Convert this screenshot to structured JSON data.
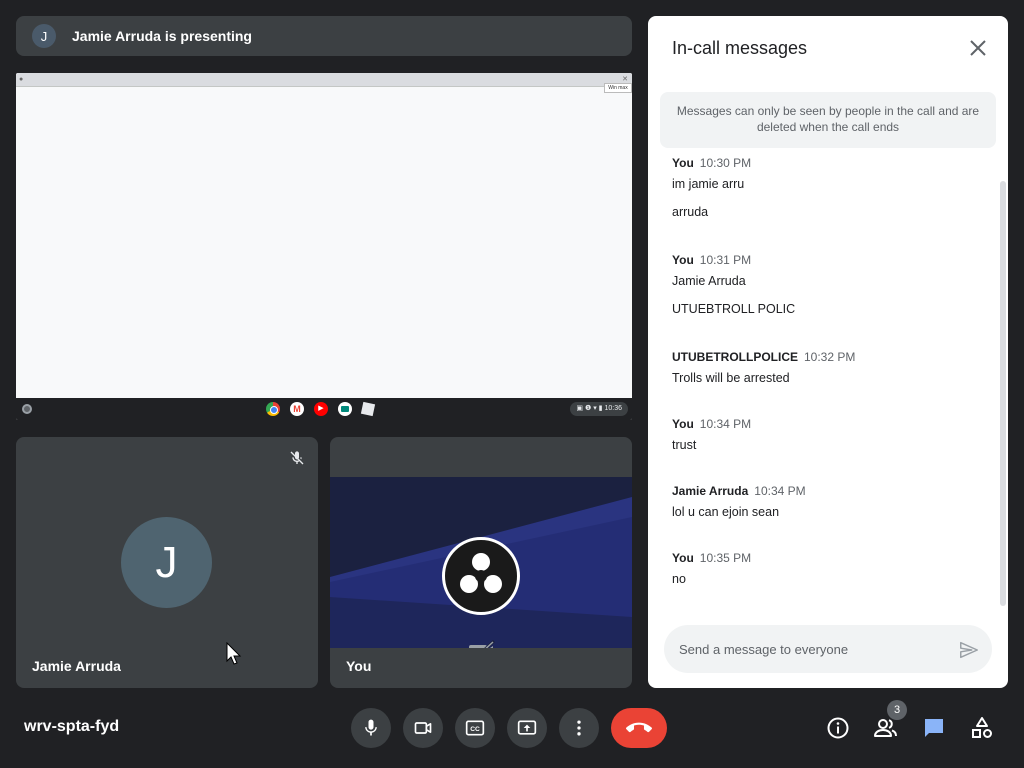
{
  "banner": {
    "avatar_initial": "J",
    "text": "Jamie Arruda is presenting"
  },
  "presentation": {
    "min_button": "Win max",
    "shelf_apps": [
      "chrome-icon",
      "gmail-icon",
      "youtube-icon",
      "meet-icon",
      "roblox-icon"
    ],
    "clock": "10:36"
  },
  "tiles": {
    "jamie": {
      "name": "Jamie Arruda",
      "initial": "J",
      "muted": true
    },
    "you": {
      "name": "You",
      "camera_off": true
    }
  },
  "chat": {
    "title": "In-call messages",
    "notice": "Messages can only be seen by people in the call and are deleted when the call ends",
    "messages": [
      {
        "sender": "You",
        "time": "10:30 PM",
        "lines": [
          "im jamie arru",
          "arruda"
        ]
      },
      {
        "sender": "You",
        "time": "10:31 PM",
        "lines": [
          "Jamie Arruda",
          "UTUEBTROLL POLIC"
        ]
      },
      {
        "sender": "UTUBETROLLPOLICE",
        "time": "10:32 PM",
        "lines": [
          "Trolls will be arrested"
        ]
      },
      {
        "sender": "You",
        "time": "10:34 PM",
        "lines": [
          "trust"
        ]
      },
      {
        "sender": "Jamie Arruda",
        "time": "10:34 PM",
        "lines": [
          "lol u can ejoin sean"
        ]
      },
      {
        "sender": "You",
        "time": "10:35 PM",
        "lines": [
          "no"
        ]
      }
    ],
    "input_placeholder": "Send a message to everyone"
  },
  "bottom_bar": {
    "meeting_code": "wrv-spta-fyd",
    "controls": [
      "mic-icon",
      "camera-icon",
      "captions-icon",
      "present-icon",
      "more-icon",
      "end-call-icon"
    ],
    "people_count": "3"
  },
  "colors": {
    "background": "#202124",
    "tile": "#3c4043",
    "end_call": "#ea4335",
    "chat_active": "#8ab4f8"
  }
}
